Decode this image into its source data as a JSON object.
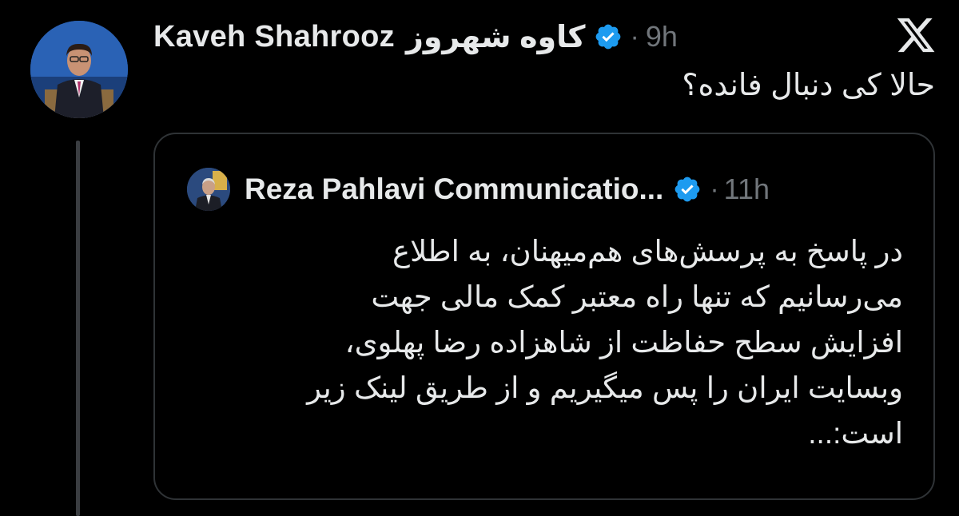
{
  "tweet": {
    "author_name": "Kaveh Shahrooz",
    "author_name_fa": "کاوه شهروز",
    "time": "9h",
    "text": "حالا کی دنبال فانده؟"
  },
  "quoted_tweet": {
    "author_name": "Reza Pahlavi Communicatio...",
    "time": "11h",
    "lines": [
      "در پاسخ به پرسش‌های هم‌میهنان، به اطلاع",
      "می‌رسانیم که تنها راه معتبر کمک مالی جهت",
      "افزایش سطح حفاظت از شاهزاده رضا پهلوی،",
      "وبسایت ایران را پس میگیریم و از طریق لینک زیر",
      "است:..."
    ]
  },
  "icons": {
    "verified": "verified-badge-icon",
    "x_logo": "x-logo-icon"
  },
  "colors": {
    "background": "#000000",
    "text": "#e7e9ea",
    "muted": "#71767b",
    "verified_blue": "#1d9bf0",
    "border": "#2f3336"
  }
}
